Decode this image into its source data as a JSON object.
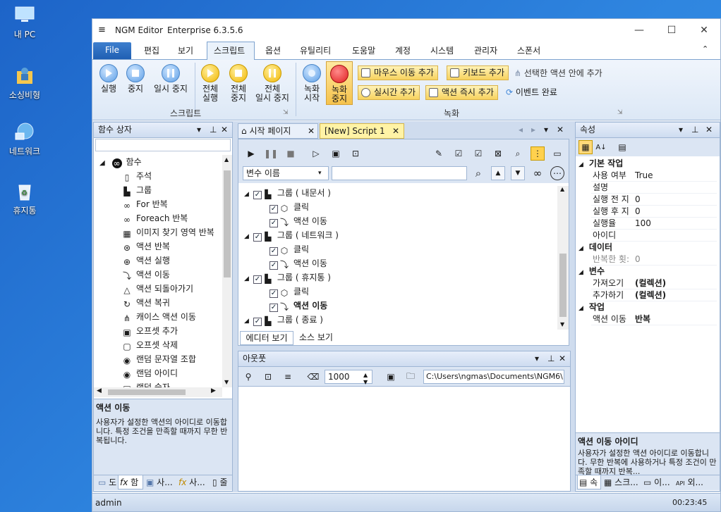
{
  "desktop": {
    "icons": [
      {
        "label": "내 PC",
        "icon": "computer-icon"
      },
      {
        "label": "소싱비형",
        "icon": "user-folder-icon"
      },
      {
        "label": "네트워크",
        "icon": "network-icon"
      },
      {
        "label": "휴지통",
        "icon": "recycle-bin-icon"
      }
    ]
  },
  "window": {
    "title": "NGM Editor",
    "edition": "Enterprise 6.3.5.6",
    "controls": {
      "minimize": "—",
      "maximize": "☐",
      "close": "✕"
    }
  },
  "menu": {
    "file": "File",
    "items": [
      "편집",
      "보기",
      "스크립트",
      "옵션",
      "유틸리티",
      "도움말",
      "계정",
      "시스템",
      "관리자",
      "스폰서"
    ],
    "active": "스크립트"
  },
  "ribbon": {
    "script_group": {
      "label": "스크립트",
      "buttons": [
        "실행",
        "중지",
        "일시 중지"
      ],
      "all_buttons": [
        {
          "line1": "전체",
          "line2": "실행"
        },
        {
          "line1": "전체",
          "line2": "중지"
        },
        {
          "line1": "전체",
          "line2": "일시 중지"
        }
      ]
    },
    "record_group": {
      "label": "녹화",
      "start": {
        "line1": "녹화",
        "line2": "시작"
      },
      "stop": {
        "line1": "녹화",
        "line2": "중지"
      },
      "mouse_add": "마우스 이동 추가",
      "keyboard_add": "키보드 추가",
      "add_in_selected": "선택한 액션 안에 추가",
      "realtime_add": "실시간 추가",
      "action_now_add": "액션 즉시 추가",
      "event_done": "이벤트 완료"
    }
  },
  "func_panel": {
    "title": "함수 상자",
    "root": "함수",
    "items": [
      {
        "label": "주석",
        "icon": "comment-icon"
      },
      {
        "label": "그룹",
        "icon": "group-icon"
      },
      {
        "label": "For 반복",
        "icon": "infinity-icon"
      },
      {
        "label": "Foreach 반복",
        "icon": "infinity-icon"
      },
      {
        "label": "이미지 찾기 영역 반복",
        "icon": "image-search-icon"
      },
      {
        "label": "액션 반복",
        "icon": "repeat-icon"
      },
      {
        "label": "액션 실행",
        "icon": "run-icon"
      },
      {
        "label": "액션 이동",
        "icon": "move-icon"
      },
      {
        "label": "액션 되돌아가기",
        "icon": "return-icon"
      },
      {
        "label": "액션 복귀",
        "icon": "restore-icon"
      },
      {
        "label": "캐이스 액션 이동",
        "icon": "case-icon"
      },
      {
        "label": "오프셋 추가",
        "icon": "offset-add-icon"
      },
      {
        "label": "오프셋 삭제",
        "icon": "offset-delete-icon"
      },
      {
        "label": "랜덤 문자열 조합",
        "icon": "random-string-icon"
      },
      {
        "label": "랜덤 아이디",
        "icon": "random-id-icon"
      },
      {
        "label": "랜덤 숫자",
        "icon": "random-number-icon"
      }
    ],
    "desc_title": "액션 이동",
    "desc_text": "사용자가 설정한 액션의 아이디로 이동합니다. 특정 조건을 만족할 때까지 무한 반복됩니다.",
    "bottom_tabs": [
      "도",
      "함",
      "사...",
      "사...",
      "줄"
    ]
  },
  "editor": {
    "tabs": [
      "시작 페이지",
      "[New] Script 1"
    ],
    "var_select": "변수 이름",
    "search_value": "",
    "tree": [
      {
        "level": 0,
        "text": "그룹 ( 내문서 )",
        "bold": false
      },
      {
        "level": 1,
        "text": "클릭",
        "bold": false
      },
      {
        "level": 1,
        "text": "액션 이동",
        "bold": false
      },
      {
        "level": 0,
        "text": "그룹 ( 네트워크 )",
        "bold": false
      },
      {
        "level": 1,
        "text": "클릭",
        "bold": false
      },
      {
        "level": 1,
        "text": "액션 이동",
        "bold": false
      },
      {
        "level": 0,
        "text": "그룹 ( 휴지통 )",
        "bold": false
      },
      {
        "level": 1,
        "text": "클릭",
        "bold": false
      },
      {
        "level": 1,
        "text": "액션 이동",
        "bold": true
      },
      {
        "level": 0,
        "text": "그룹 ( 종료 )",
        "bold": false
      }
    ],
    "view_tabs": [
      "에디터 보기",
      "소스 보기"
    ]
  },
  "output": {
    "title": "아웃풋",
    "count": "1000",
    "path": "C:\\Users\\ngmas\\Documents\\NGM6\\"
  },
  "props": {
    "title": "속성",
    "categories": [
      {
        "name": "기본 작업",
        "rows": [
          {
            "key": "사용 여부",
            "value": "True"
          },
          {
            "key": "설명",
            "value": ""
          },
          {
            "key": "실행 전 지",
            "value": "0"
          },
          {
            "key": "실행 후 지",
            "value": "0"
          },
          {
            "key": "실행율",
            "value": "100"
          },
          {
            "key": "아이디",
            "value": ""
          }
        ]
      },
      {
        "name": "데이터",
        "rows": [
          {
            "key": "반복한 횟:",
            "value": "0"
          }
        ]
      },
      {
        "name": "변수",
        "rows": [
          {
            "key": "가져오기",
            "value": "(컬렉션)"
          },
          {
            "key": "추가하기",
            "value": "(컬렉션)"
          }
        ]
      },
      {
        "name": "작업",
        "rows": [
          {
            "key": "액션 이동",
            "value": "반복"
          }
        ]
      }
    ],
    "desc_title": "액션 이동 아이디",
    "desc_text": "사용자가 설정한 액션 아이디로 이동합니다. 무한 반복에 사용하거나 특정 조건이 만족할 때까지 반복...",
    "bottom_tabs": [
      "속",
      "스크...",
      "이...",
      "외..."
    ]
  },
  "status": {
    "user": "admin",
    "time": "00:23:45"
  },
  "colors": {
    "accent": "#1f5fb3",
    "ribbon_highlight": "#f7d25e",
    "record_red": "#e02020",
    "script_tab": "#fff3a6"
  }
}
